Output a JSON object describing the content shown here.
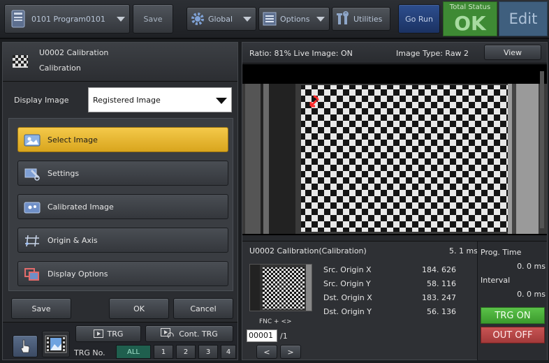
{
  "toolbar": {
    "program_label": "0101 Program0101",
    "save_label": "Save",
    "global_label": "Global",
    "options_label": "Options",
    "utilities_label": "Utilities",
    "go_run_label": "Go Run",
    "total_status_label": "Total Status",
    "total_status_value": "OK",
    "edit_label": "Edit"
  },
  "unit": {
    "title": "U0002 Calibration",
    "subtitle": "Calibration"
  },
  "display": {
    "label": "Display Image",
    "selected": "Registered Image"
  },
  "menu": {
    "items": [
      {
        "label": "Select Image",
        "icon": "select-image-icon"
      },
      {
        "label": "Settings",
        "icon": "settings-icon"
      },
      {
        "label": "Calibrated Image",
        "icon": "calibrated-image-icon"
      },
      {
        "label": "Origin & Axis",
        "icon": "origin-axis-icon"
      },
      {
        "label": "Display Options",
        "icon": "display-options-icon"
      }
    ]
  },
  "actions": {
    "save": "Save",
    "ok": "OK",
    "cancel": "Cancel"
  },
  "trigger": {
    "trg_label": "TRG",
    "cont_trg_label": "Cont. TRG",
    "trg_no_label": "TRG No.",
    "numbers": [
      "ALL",
      "1",
      "2",
      "3",
      "4"
    ]
  },
  "image_info": {
    "ratio_text": "Ratio: 81%  Live Image: ON",
    "image_type_text": "Image Type: Raw 2",
    "view_label": "View"
  },
  "result": {
    "title": "U0002 Calibration(Calibration)",
    "time": "5. 1 ms",
    "rows": [
      {
        "name": "Src. Origin X",
        "value": "184. 626"
      },
      {
        "name": "Src. Origin Y",
        "value": "58. 116"
      },
      {
        "name": "Dst. Origin X",
        "value": "183. 247"
      },
      {
        "name": "Dst. Origin Y",
        "value": "56. 136"
      }
    ],
    "fnc_label": "FNC + <>",
    "fnc_value": "00001",
    "fnc_total": "/1",
    "prev_label": "<",
    "next_label": ">"
  },
  "prog": {
    "time_label": "Prog. Time",
    "time_value": "0. 0 ms",
    "interval_label": "Interval",
    "interval_value": "0. 0 ms",
    "trg_on_label": "TRG ON",
    "out_off_label": "OUT OFF"
  },
  "colors": {
    "status_ok": "#3e8a34",
    "active_menu": "#f4c94a",
    "trg_on": "#4caf3b",
    "out_off": "#b84646"
  }
}
